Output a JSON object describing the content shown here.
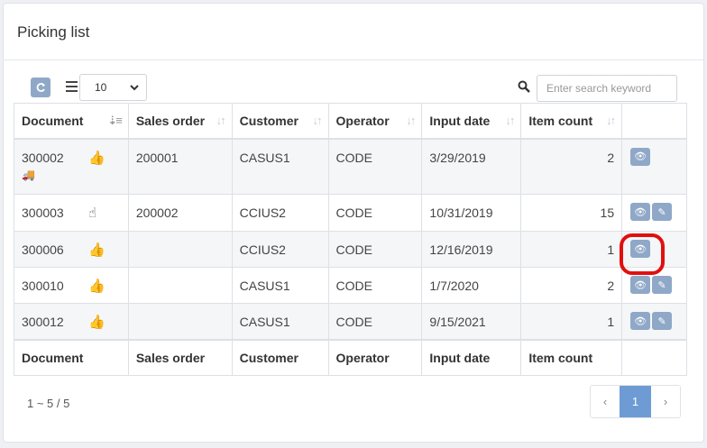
{
  "title": "Picking list",
  "toolbar": {
    "page_size": "10",
    "search_placeholder": "Enter search keyword"
  },
  "columns": [
    "Document",
    "Sales order",
    "Customer",
    "Operator",
    "Input date",
    "Item count"
  ],
  "rows": [
    {
      "document": "300002",
      "sales_order": "200001",
      "customer": "CASUS1",
      "operator": "CODE",
      "input_date": "3/29/2019",
      "item_count": "2"
    },
    {
      "document": "300003",
      "sales_order": "200002",
      "customer": "CCIUS2",
      "operator": "CODE",
      "input_date": "10/31/2019",
      "item_count": "15"
    },
    {
      "document": "300006",
      "sales_order": "",
      "customer": "CCIUS2",
      "operator": "CODE",
      "input_date": "12/16/2019",
      "item_count": "1"
    },
    {
      "document": "300010",
      "sales_order": "",
      "customer": "CASUS1",
      "operator": "CODE",
      "input_date": "1/7/2020",
      "item_count": "2"
    },
    {
      "document": "300012",
      "sales_order": "",
      "customer": "CASUS1",
      "operator": "CODE",
      "input_date": "9/15/2021",
      "item_count": "1"
    }
  ],
  "pagination": {
    "info": "1 ~ 5 / 5",
    "prev": "‹",
    "current": "1",
    "next": "›"
  },
  "colors": {
    "button": "#8fa8c8",
    "active_page": "#6f9bd4",
    "highlight": "#e01010"
  }
}
